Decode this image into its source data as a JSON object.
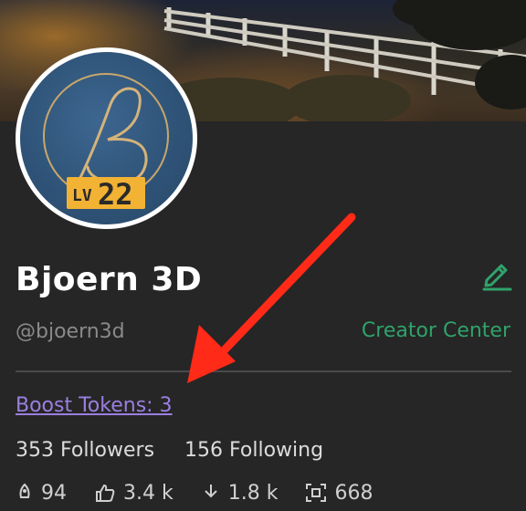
{
  "profile": {
    "name": "Bjoern 3D",
    "handle": "@bjoern3d",
    "level_prefix": "LV",
    "level": "22"
  },
  "actions": {
    "creator_center": "Creator Center",
    "boost_tokens": "Boost Tokens: 3"
  },
  "follow": {
    "followers": "353 Followers",
    "following": "156 Following"
  },
  "stats": {
    "uploads": "94",
    "likes": "3.4 k",
    "downloads": "1.8 k",
    "models": "668"
  },
  "colors": {
    "background": "#262626",
    "accent_green": "#2fa36b",
    "boost_purple": "#9b7fe0",
    "level_badge": "#f2b233",
    "annotation_arrow": "#ff2a17"
  },
  "icons": [
    "pencil-icon",
    "rocket-icon",
    "thumbs-up-icon",
    "download-icon",
    "scan-icon"
  ]
}
